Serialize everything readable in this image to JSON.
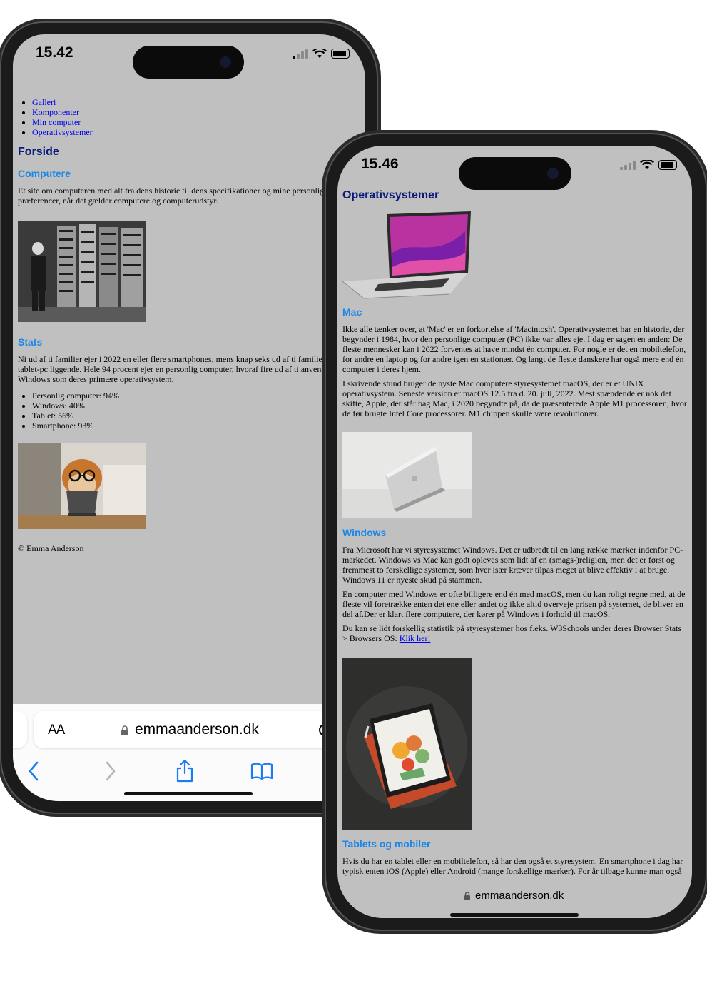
{
  "left_phone": {
    "status_time": "15.42",
    "nav_links": [
      "Galleri",
      "Komponenter",
      "Min computer",
      "Operativsystemer"
    ],
    "title": "Forside",
    "sections": {
      "computere": {
        "heading": "Computere",
        "text": "Et site om computeren med alt fra dens historie til dens specifikationer og mine personlige præferencer, når det gælder computere og computerudstyr."
      },
      "stats": {
        "heading": "Stats",
        "text": "Ni ud af ti familier ejer i 2022 en eller flere smartphones, mens knap seks ud af ti familier har en tablet-pc liggende. Hele 94 procent ejer en personlig computer, hvoraf fire ud af ti anvender Windows som deres primære operativsystem.",
        "list": [
          "Personlig computer: 94%",
          "Windows: 40%",
          "Tablet: 56%",
          "Smartphone: 93%"
        ]
      }
    },
    "footer": "© Emma Anderson",
    "safari": {
      "aa_label": "AA",
      "url": "emmaanderson.dk"
    }
  },
  "right_phone": {
    "status_time": "15.46",
    "title": "Operativsystemer",
    "mac": {
      "heading": "Mac",
      "p1": "Ikke alle tænker over, at 'Mac' er en forkortelse af 'Macintosh'. Operativsystemet har en historie, der begynder i 1984, hvor den personlige computer (PC) ikke var alles eje. I dag er sagen en anden: De fleste mennesker kan i 2022 forventes at have mindst én computer. For nogle er det en mobiltelefon, for andre en laptop og for andre igen en stationær. Og langt de fleste danskere har også mere end én computer i deres hjem.",
      "p2": "I skrivende stund bruger de nyste Mac computere styresystemet macOS, der er et UNIX operativsystem. Seneste version er macOS 12.5 fra d. 20. juli, 2022. Mest spændende er nok det skifte, Apple, der står bag Mac, i 2020 begyndte på, da de præsenterede Apple M1 processoren, hvor de før brugte Intel Core processorer. M1 chippen skulle være revolutionær."
    },
    "windows": {
      "heading": "Windows",
      "p1": "Fra Microsoft har vi styresystemet Windows. Det er udbredt til en lang række mærker indenfor PC-markedet. Windows vs Mac kan godt opleves som lidt af en (smags-)religion, men det er først og fremmest to forskellige systemer, som hver især kræver tilpas meget at blive effektiv i at bruge. Windows 11 er nyeste skud på stammen.",
      "p2": "En computer med Windows er ofte billigere end én med macOS, men du kan roligt regne med, at de fleste vil foretrække enten det ene eller andet og ikke altid overveje prisen på systemet, de bliver en del af.Der er klart flere computere, der kører på Windows i forhold til macOS.",
      "p3": "Du kan se lidt forskellig statistik på styresystemer hos f.eks. W3Schools under deres Browser Stats > Browsers OS:",
      "link": "Klik her!"
    },
    "tablets": {
      "heading": "Tablets og mobiler",
      "p1": "Hvis du har en tablet eller en mobiltelefon, så har den også et styresystem. En smartphone i dag har typisk enten iOS (Apple) eller Android (mange forskellige mærker). For år tilbage kunne man også"
    },
    "url": "emmaanderson.dk"
  },
  "colors": {
    "page_bg": "#c0c0c0",
    "heading_dark": "#0a1c7a",
    "heading_blue": "#1a86e8",
    "link": "#0000ee",
    "safari_blue": "#1a7cf5"
  },
  "icons": [
    "lock-icon",
    "back-chevron-icon",
    "forward-chevron-icon",
    "share-icon",
    "bookmarks-icon",
    "reload-icon",
    "wifi-icon",
    "battery-icon",
    "signal-icon"
  ]
}
